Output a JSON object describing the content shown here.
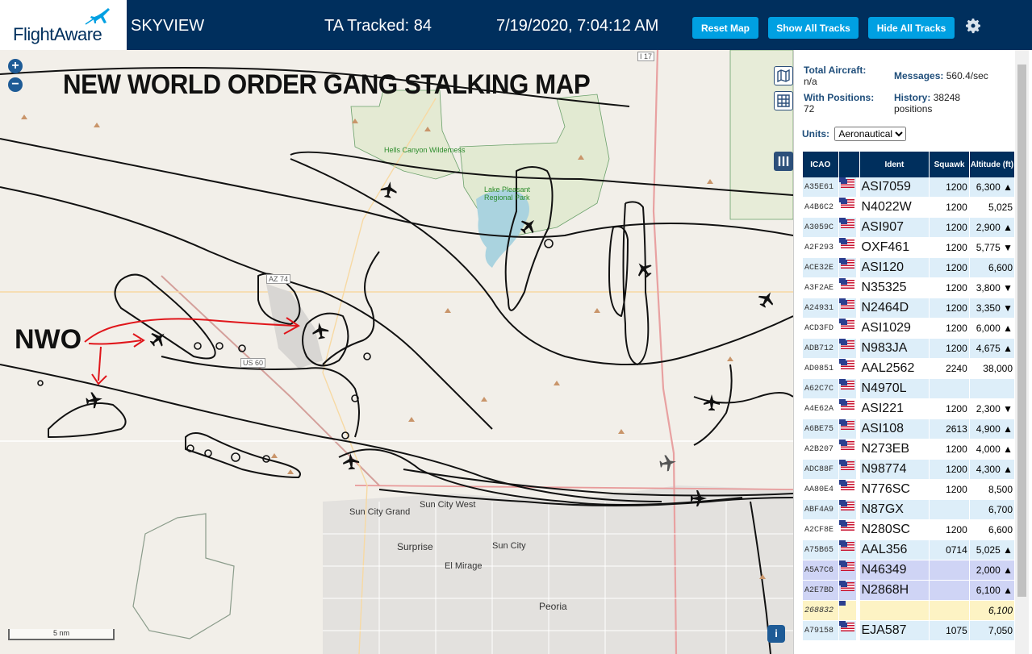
{
  "header": {
    "logo": "FlightAware",
    "app_name": "SKYVIEW",
    "ta_tracked": "TA Tracked: 84",
    "datetime": "7/19/2020, 7:04:12 AM",
    "buttons": {
      "reset_map": "Reset Map",
      "show_all": "Show All Tracks",
      "hide_all": "Hide All Tracks"
    },
    "accent_color": "#00a0e2",
    "bar_color": "#002f5d"
  },
  "map": {
    "overlay_title": "NEW WORLD ORDER GANG STALKING MAP",
    "annotation": "NWO",
    "zoom_in": "+",
    "zoom_out": "−",
    "scale_label": "5 nm",
    "info": "i",
    "places": {
      "hells_canyon": "Hells Canyon Wilderness",
      "lake_pleasant": "Lake Pleasant Regional Park",
      "sun_city_grand": "Sun City Grand",
      "sun_city_west": "Sun City West",
      "surprise": "Surprise",
      "sun_city": "Sun City",
      "el_mirage": "El Mirage",
      "peoria": "Peoria",
      "az74": "AZ 74",
      "us60": "US 60",
      "i17": "I 17"
    }
  },
  "sidebar": {
    "total_aircraft_label": "Total Aircraft:",
    "total_aircraft_value": "n/a",
    "with_positions_label": "With Positions:",
    "with_positions_value": "72",
    "messages_label": "Messages:",
    "messages_value": "560.4/sec",
    "history_label": "History:",
    "history_value": "38248",
    "history_unit": "positions",
    "units_label": "Units:",
    "units_selected": "Aeronautical",
    "columns": [
      "ICAO",
      "",
      "Ident",
      "Squawk",
      "Altitude (ft)"
    ],
    "rows": [
      {
        "icao": "A35E61",
        "flag": true,
        "ident": "ASI7059",
        "squawk": "1200",
        "alt": "6,300 ▲",
        "style": ""
      },
      {
        "icao": "A4B6C2",
        "flag": true,
        "ident": "N4022W",
        "squawk": "1200",
        "alt": "5,025",
        "style": ""
      },
      {
        "icao": "A3059C",
        "flag": true,
        "ident": "ASI907",
        "squawk": "1200",
        "alt": "2,900 ▲",
        "style": ""
      },
      {
        "icao": "A2F293",
        "flag": true,
        "ident": "OXF461",
        "squawk": "1200",
        "alt": "5,775 ▼",
        "style": ""
      },
      {
        "icao": "ACE32E",
        "flag": true,
        "ident": "ASI120",
        "squawk": "1200",
        "alt": "6,600",
        "style": ""
      },
      {
        "icao": "A3F2AE",
        "flag": true,
        "ident": "N35325",
        "squawk": "1200",
        "alt": "3,800 ▼",
        "style": ""
      },
      {
        "icao": "A24931",
        "flag": true,
        "ident": "N2464D",
        "squawk": "1200",
        "alt": "3,350 ▼",
        "style": ""
      },
      {
        "icao": "ACD3FD",
        "flag": true,
        "ident": "ASI1029",
        "squawk": "1200",
        "alt": "6,000 ▲",
        "style": ""
      },
      {
        "icao": "ADB712",
        "flag": true,
        "ident": "N983JA",
        "squawk": "1200",
        "alt": "4,675 ▲",
        "style": ""
      },
      {
        "icao": "AD0851",
        "flag": true,
        "ident": "AAL2562",
        "squawk": "2240",
        "alt": "38,000",
        "style": ""
      },
      {
        "icao": "A62C7C",
        "flag": true,
        "ident": "N4970L",
        "squawk": "",
        "alt": "",
        "style": ""
      },
      {
        "icao": "A4E62A",
        "flag": true,
        "ident": "ASI221",
        "squawk": "1200",
        "alt": "2,300 ▼",
        "style": ""
      },
      {
        "icao": "A6BE75",
        "flag": true,
        "ident": "ASI108",
        "squawk": "2613",
        "alt": "4,900 ▲",
        "style": ""
      },
      {
        "icao": "A2B207",
        "flag": true,
        "ident": "N273EB",
        "squawk": "1200",
        "alt": "4,000 ▲",
        "style": ""
      },
      {
        "icao": "ADC88F",
        "flag": true,
        "ident": "N98774",
        "squawk": "1200",
        "alt": "4,300 ▲",
        "style": ""
      },
      {
        "icao": "AA80E4",
        "flag": true,
        "ident": "N776SC",
        "squawk": "1200",
        "alt": "8,500",
        "style": ""
      },
      {
        "icao": "ABF4A9",
        "flag": true,
        "ident": "N87GX",
        "squawk": "",
        "alt": "6,700",
        "style": ""
      },
      {
        "icao": "A2CF8E",
        "flag": true,
        "ident": "N280SC",
        "squawk": "1200",
        "alt": "6,600",
        "style": ""
      },
      {
        "icao": "A75B65",
        "flag": true,
        "ident": "AAL356",
        "squawk": "0714",
        "alt": "5,025 ▲",
        "style": ""
      },
      {
        "icao": "A5A7C6",
        "flag": true,
        "ident": "N46349",
        "squawk": "",
        "alt": "2,000 ▲",
        "style": "hl"
      },
      {
        "icao": "A2E7BD",
        "flag": true,
        "ident": "N2868H",
        "squawk": "",
        "alt": "6,100 ▲",
        "style": "hl"
      },
      {
        "icao": "268832",
        "flag": false,
        "ident": "",
        "squawk": "",
        "alt": "6,100",
        "style": "yl"
      },
      {
        "icao": "A79158",
        "flag": true,
        "ident": "EJA587",
        "squawk": "1075",
        "alt": "7,050",
        "style": ""
      }
    ]
  }
}
